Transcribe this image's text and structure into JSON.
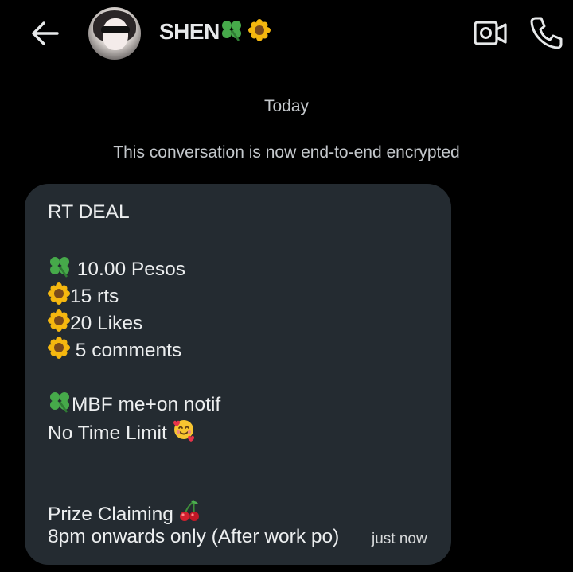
{
  "header": {
    "back_icon": "arrow-left-icon",
    "contact_name": "SHEN",
    "name_emojis": [
      "clover",
      "sunflower"
    ],
    "video_icon": "video-camera-icon",
    "call_icon": "phone-icon"
  },
  "conversation": {
    "date_separator": "Today",
    "encryption_notice": "This conversation is now end-to-end encrypted"
  },
  "message": {
    "lines": {
      "l1": "RT DEAL",
      "l2": " 10.00 Pesos",
      "l3": "15 rts",
      "l4": "20 Likes",
      "l5": " 5 comments",
      "l6": "MBF me+on notif",
      "l7": "No Time Limit",
      "l8": "Prize Claiming",
      "l9": "8pm onwards only (After work po)"
    },
    "timestamp": "just now",
    "bubble_color": "#242b31"
  },
  "colors": {
    "background": "#000000",
    "text": "#e7e9ea",
    "muted": "#c4c8cc"
  }
}
